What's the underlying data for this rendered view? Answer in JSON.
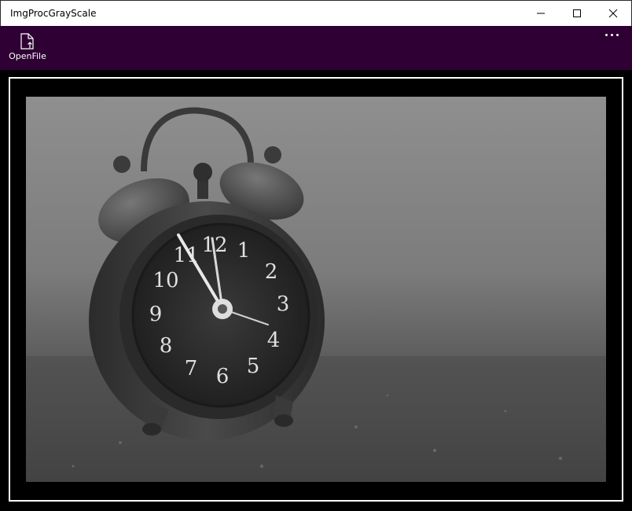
{
  "window": {
    "title": "ImgProcGrayScale"
  },
  "appbar": {
    "openfile_label": "OpenFile",
    "openfile_icon": "open-file-icon",
    "more_icon": "more-ellipsis-icon"
  },
  "image": {
    "description_icon": "grayscale-alarm-clock-photo",
    "clock_numerals": [
      "12",
      "1",
      "2",
      "3",
      "4",
      "5",
      "6",
      "7",
      "8",
      "9",
      "10",
      "11"
    ]
  },
  "colors": {
    "appbar_bg": "#2e0033",
    "titlebar_bg": "#ffffff",
    "content_bg": "#000000",
    "frame_border": "#ffffff"
  }
}
